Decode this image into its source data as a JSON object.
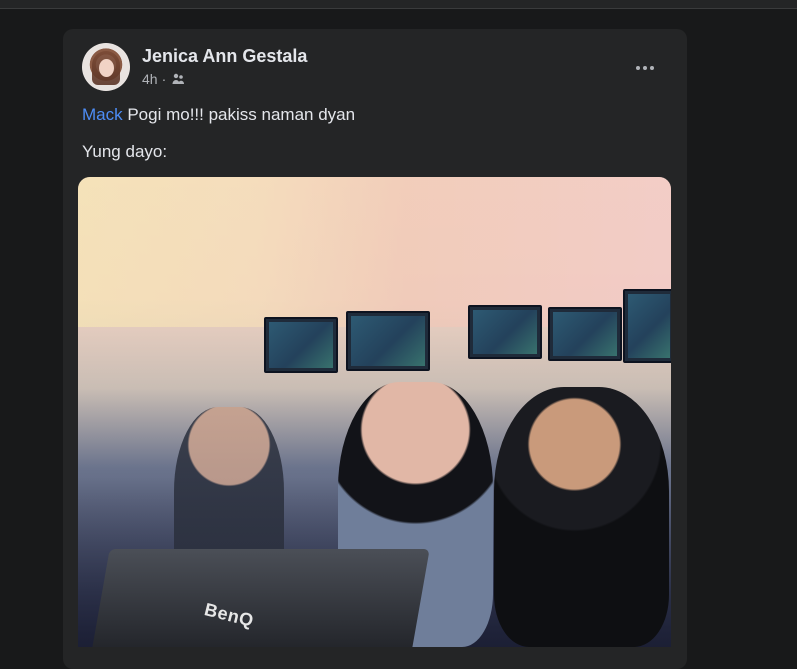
{
  "post": {
    "author_name": "Jenica Ann Gestala",
    "time": "4h",
    "separator": "·",
    "privacy_icon": "friends-icon",
    "more_icon": "more-options-icon",
    "mention": "Mack",
    "line1_rest": " Pogi mo!!! pakiss naman dyan",
    "line2": "Yung dayo:",
    "photo": {
      "laptop_logo_text": "BenQ"
    }
  },
  "colors": {
    "background": "#18191a",
    "card": "#242526",
    "text_primary": "#e4e6eb",
    "text_secondary": "#b0b3b8",
    "mention": "#4d8df6"
  }
}
